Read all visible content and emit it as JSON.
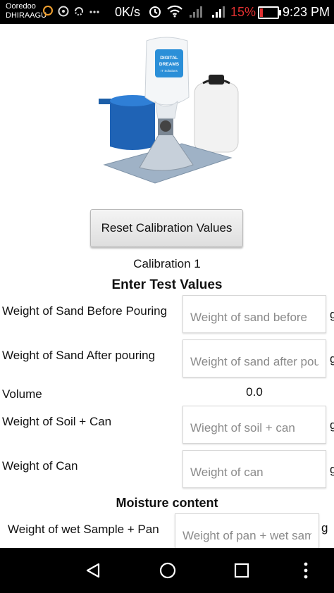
{
  "status_bar": {
    "carrier_line1": "Ooredoo",
    "carrier_line2": "DHIRAAGU",
    "data_speed": "0K/s",
    "battery_percent": "15%",
    "battery_level": 0.15,
    "time": "9:23 PM",
    "colors": {
      "battery_low": "#e03030",
      "notification": "#f0a030"
    }
  },
  "hero_logo": {
    "line1": "DIGITAL",
    "line2": "DREAMS",
    "line3": "IT Solutions"
  },
  "reset_button_label": "Reset Calibration Values",
  "calibration_title": "Calibration 1",
  "section_title": "Enter Test  Values",
  "fields": {
    "sand_before": {
      "label": "Weight of Sand Before Pouring",
      "placeholder": "Weight of sand before",
      "unit": "g",
      "value": ""
    },
    "sand_after": {
      "label": "Weight of Sand After pouring",
      "placeholder": "Weight of sand after pouring",
      "unit": "g",
      "value": ""
    },
    "volume": {
      "label": "Volume",
      "value": "0.0"
    },
    "soil_can": {
      "label": "Weight of Soil + Can",
      "placeholder": "Wieght of soil + can",
      "unit": "g",
      "value": ""
    },
    "can": {
      "label": "Weight of Can",
      "placeholder": "Weight of can",
      "unit": "g",
      "value": ""
    }
  },
  "moisture": {
    "title": "Moisture content",
    "wet_sample_pan": {
      "label": "Weight of wet Sample + Pan",
      "placeholder": "Weight of pan + wet sample",
      "unit": "g",
      "value": ""
    }
  },
  "nav_bar": {
    "icons": [
      "back-icon",
      "home-icon",
      "recent-apps-icon",
      "menu-icon"
    ]
  }
}
